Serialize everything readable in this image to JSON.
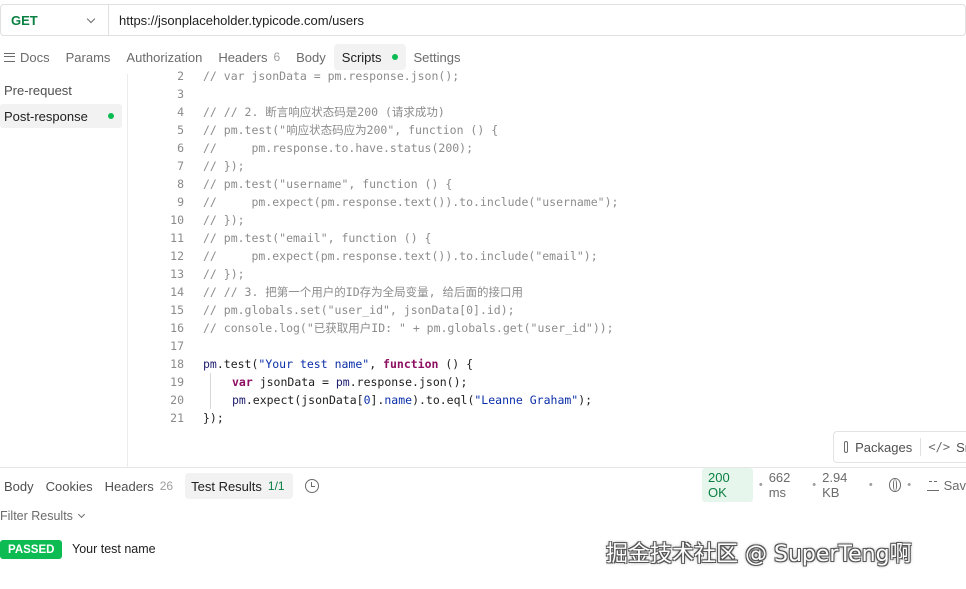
{
  "request": {
    "method": "GET",
    "url": "https://jsonplaceholder.typicode.com/users"
  },
  "request_tabs": {
    "docs": "Docs",
    "params": "Params",
    "authorization": "Authorization",
    "headers": "Headers",
    "headers_count": "6",
    "body": "Body",
    "scripts": "Scripts",
    "settings": "Settings"
  },
  "scripts_nav": {
    "pre_request": "Pre-request",
    "post_response": "Post-response"
  },
  "editor": {
    "line_numbers": [
      "2",
      "3",
      "4",
      "5",
      "6",
      "7",
      "8",
      "9",
      "10",
      "11",
      "12",
      "13",
      "14",
      "15",
      "16",
      "17",
      "18",
      "19",
      "20",
      "21"
    ],
    "comments": {
      "l2": "// var jsonData = pm.response.json();",
      "l4": "// // 2. 断言响应状态码是200 (请求成功)",
      "l5": "// pm.test(\"响应状态码应为200\", function () {",
      "l6": "//     pm.response.to.have.status(200);",
      "l7": "// });",
      "l8": "// pm.test(\"username\", function () {",
      "l9": "//     pm.expect(pm.response.text()).to.include(\"username\");",
      "l10": "// });",
      "l11": "// pm.test(\"email\", function () {",
      "l12": "//     pm.expect(pm.response.text()).to.include(\"email\");",
      "l13": "// });",
      "l14": "// // 3. 把第一个用户的ID存为全局变量, 给后面的接口用",
      "l15": "// pm.globals.set(\"user_id\", jsonData[0].id);",
      "l16": "// console.log(\"已获取用户ID: \" + pm.globals.get(\"user_id\"));"
    },
    "code": {
      "l18_a": "pm",
      "l18_b": ".test(",
      "l18_str": "\"Your test name\"",
      "l18_c": ", ",
      "l18_kw": "function",
      "l18_d": " () {",
      "l19_kw": "var",
      "l19_a": " jsonData = ",
      "l19_b": "pm",
      "l19_c": ".response.json();",
      "l20_a": "pm",
      "l20_b": ".expect(jsonData[",
      "l20_num": "0",
      "l20_c": "].",
      "l20_name": "name",
      "l20_d": ").to.eql(",
      "l20_str": "\"Leanne Graham\"",
      "l20_e": ");",
      "l21": "});"
    }
  },
  "editor_footer": {
    "packages": "Packages",
    "snippets_partial": "Sn"
  },
  "response": {
    "tabs": {
      "body": "Body",
      "cookies": "Cookies",
      "headers": "Headers",
      "headers_count": "26",
      "test_results": "Test Results",
      "test_results_count": "1/1"
    },
    "status": "200 OK",
    "time": "662 ms",
    "size": "2.94 KB",
    "save_partial": "Sav",
    "filter_label": "Filter Results",
    "results": [
      {
        "badge": "PASSED",
        "name": "Your test name"
      }
    ]
  },
  "watermark": "掘金技术社区 @ SuperTeng啊",
  "colors": {
    "method": "#0b8043",
    "passed": "#0cbb52",
    "status_ok_bg": "#e7f6ec",
    "keyword": "#8d0f61",
    "string": "#0b2fa8",
    "comment": "#8c8c8c"
  },
  "icons": [
    "chevron-down-icon",
    "docs-icon",
    "history-icon",
    "globe-icon",
    "save-icon",
    "package-icon",
    "code-icon"
  ]
}
